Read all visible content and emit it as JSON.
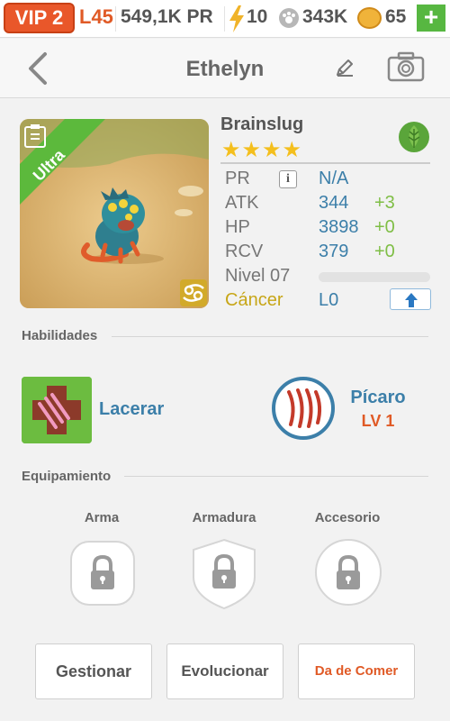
{
  "status": {
    "vip": "VIP 2",
    "level": "L45",
    "pr": "549,1K PR",
    "energy": "10",
    "paws": "343K",
    "coins": "65",
    "add_label": "+"
  },
  "nav": {
    "back_icon": "chevron-left-icon",
    "title": "Ethelyn",
    "edit_icon": "pencil-icon",
    "camera_icon": "camera-icon"
  },
  "monster": {
    "rarity": "Ultra",
    "species": "Brainslug",
    "stars": "★★★★",
    "star_count": 4,
    "element_icon": "leaf-icon",
    "stats": [
      {
        "label": "PR",
        "value": "N/A",
        "bonus": ""
      },
      {
        "label": "ATK",
        "value": "344",
        "bonus": "+3"
      },
      {
        "label": "HP",
        "value": "3898",
        "bonus": "+0"
      },
      {
        "label": "RCV",
        "value": "379",
        "bonus": "+0"
      }
    ],
    "level_label": "Nivel 07",
    "xp_fraction": 0,
    "zodiac_label": "Cáncer",
    "zodiac_value": "L0",
    "colors": {
      "accent_blue": "#3c7fa9",
      "bonus_green": "#7fbe46",
      "zodiac": "#c7a617",
      "orange": "#e05a26"
    }
  },
  "skills": {
    "section_label": "Habilidades",
    "items": [
      {
        "name": "Lacerar",
        "icon": "claw-cross-icon"
      },
      {
        "name": "Pícaro",
        "level": "LV 1",
        "icon": "claw-marks-icon"
      }
    ]
  },
  "equipment": {
    "section_label": "Equipamiento",
    "slots": [
      {
        "label": "Arma",
        "icon": "lock-icon"
      },
      {
        "label": "Armadura",
        "icon": "lock-icon"
      },
      {
        "label": "Accesorio",
        "icon": "lock-icon"
      }
    ]
  },
  "actions": {
    "manage": "Gestionar",
    "evolve": "Evolucionar",
    "feed": "Da de Comer"
  }
}
